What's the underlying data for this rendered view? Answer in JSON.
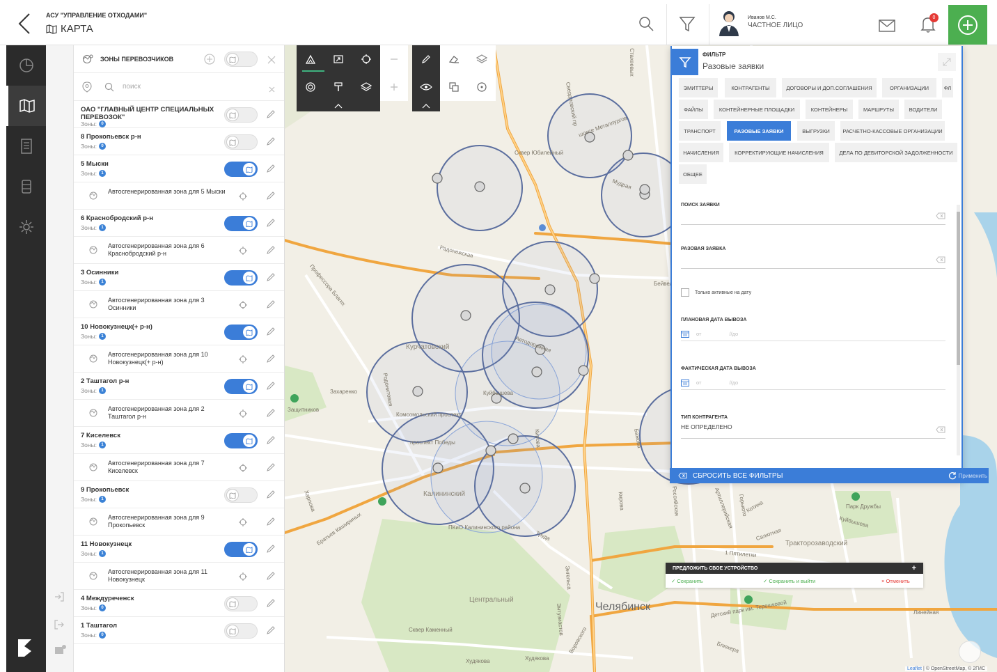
{
  "header": {
    "app_title": "АСУ \"УПРАВЛЕНИЕ ОТХОДАМИ\"",
    "page_title": "КАРТА",
    "user_name": "Иванов М.С.",
    "user_role": "ЧАСТНОЕ ЛИЦО",
    "notifications_count": "0"
  },
  "zones_panel": {
    "title": "ЗОНЫ ПЕРЕВОЗЧИКОВ",
    "search_placeholder": "поиск",
    "zones_label": "Зоны:",
    "items": [
      {
        "name": "ОАО \"ГЛАВНЫЙ ЦЕНТР СПЕЦИАЛЬНЫХ ПЕРЕВОЗОК\"",
        "count": "0",
        "on": false
      },
      {
        "name": "8 Прокопьевск р-н",
        "count": "0",
        "on": false
      },
      {
        "name": "5 Мыски",
        "count": "1",
        "on": true,
        "sub": "Автосгенерированная зона для 5 Мыски"
      },
      {
        "name": "6 Краснобродский р-н",
        "count": "1",
        "on": true,
        "sub": "Автосгенерированная зона для 6 Краснобродский р-н"
      },
      {
        "name": "3 Осинники",
        "count": "1",
        "on": true,
        "sub": "Автосгенерированная зона для 3 Осинники"
      },
      {
        "name": "10 Новокузнецк(+ р-н)",
        "count": "1",
        "on": true,
        "sub": "Автосгенерированная зона для 10 Новокузнецк(+ р-н)"
      },
      {
        "name": "2 Таштагол р-н",
        "count": "1",
        "on": true,
        "sub": "Автосгенерированная зона для 2 Таштагол р-н"
      },
      {
        "name": "7 Киселевск",
        "count": "1",
        "on": true,
        "sub": "Автосгенерированная зона для 7 Киселевск"
      },
      {
        "name": "9 Прокопьевск",
        "count": "1",
        "on": false,
        "sub": "Автосгенерированная зона для 9 Прокопьевск"
      },
      {
        "name": "11 Новокузнецк",
        "count": "1",
        "on": true,
        "sub": "Автосгенерированная зона для 11 Новокузнецк"
      },
      {
        "name": "4 Междуреченск",
        "count": "0",
        "on": false
      },
      {
        "name": "1 Таштагол",
        "count": "0",
        "on": false
      }
    ]
  },
  "filter": {
    "label": "ФИЛЬТР",
    "current": "Разовые заявки",
    "chips": [
      "ЭМИТТЕРЫ",
      "КОНТРАГЕНТЫ",
      "ДОГОВОРЫ И ДОП.СОГЛАШЕНИЯ",
      "ОРГАНИЗАЦИИ",
      "ФЛ",
      "ФАЙЛЫ",
      "КОНТЕЙНЕРНЫЕ ПЛОЩАДКИ",
      "КОНТЕЙНЕРЫ",
      "МАРШРУТЫ",
      "ВОДИТЕЛИ",
      "ТРАНСПОРТ",
      "РАЗОВЫЕ ЗАЯВКИ",
      "ВЫГРУЗКИ",
      "РАСЧЕТНО-КАССОВЫЕ ОРГАНИЗАЦИИ",
      "НАЧИСЛЕНИЯ",
      "КОРРЕКТИРУЮЩИЕ НАЧИСЛЕНИЯ",
      "ДЕЛА ПО ДЕБИТОРСКОЙ ЗАДОЛЖЕННОСТИ",
      "ОБЩЕЕ"
    ],
    "search_label": "ПОИСК ЗАЯВКИ",
    "single_label": "РАЗОВАЯ ЗАЯВКА",
    "only_active": "Только активные на дату",
    "planned_label": "ПЛАНОВАЯ ДАТА ВЫВОЗА",
    "actual_label": "ФАКТИЧЕСКАЯ ДАТА ВЫВОЗА",
    "from": "от",
    "to": "//до",
    "contractor_label": "ТИП КОНТРАГЕНТА",
    "contractor_value": "НЕ ОПРЕДЕЛЕНО",
    "reset": "СБРОСИТЬ ВСЕ ФИЛЬТРЫ",
    "apply": "Применить"
  },
  "suggest": {
    "title": "ПРЕДЛОЖИТЬ СВОЕ УСТРОЙСТВО",
    "save": "✓ Сохранить",
    "save_exit": "✓ Сохранить и выйти",
    "cancel": "× Отменить"
  },
  "map": {
    "labels": {
      "city": "Челябинск",
      "d1": "Курчатовский",
      "d2": "Калининский",
      "d3": "Центральный",
      "d4": "Тракторозаводский",
      "s1": "Радонежская",
      "s2": "Профессора Благих",
      "s3": "Комсомольский проспект",
      "s4": "проспект Победы",
      "s5": "Захаренко",
      "s6": "Кирова",
      "s7": "Свердловский пр",
      "s8": "шоссе Металлургов",
      "s9": "Братьев Кашириных",
      "s10": "Труда",
      "s11": "Сквер Юбилейный",
      "s12": "Куйбышева",
      "s13": "Автодорожная",
      "s14": "Парк Дружбы",
      "s15": "Куйбышева",
      "s16": "Салютная",
      "s17": "Линейная",
      "s18": "Детский парк им. Терешковой",
      "s19": "Худякова",
      "s20": "Худякова",
      "s21": "Энтузиастов",
      "s22": "Воровского",
      "s23": "Энгельса",
      "s24": "1 Пятилетки",
      "s25": "Горького",
      "s26": "Котина",
      "s27": "Артиллерийская",
      "s28": "Российская",
      "s29": "Кирова",
      "s30": "Бейвеля",
      "s31": "Мудрая",
      "s32": "Стахеевых",
      "s33": "Сквер Каменный",
      "s34": "ПКиО Калининского района",
      "s35": "Родонитовая",
      "s36": "Харлова",
      "s37": "Защитников",
      "s38": "Бажова",
      "s39": "Блюхера"
    },
    "attribution_leaflet": "Leaflet",
    "attribution_rest": "| © OpenStreetMap, © 2ГИС"
  },
  "colors": {
    "accent": "#3b7dd8",
    "add": "#4caf50",
    "nav": "#2b2b2b"
  }
}
